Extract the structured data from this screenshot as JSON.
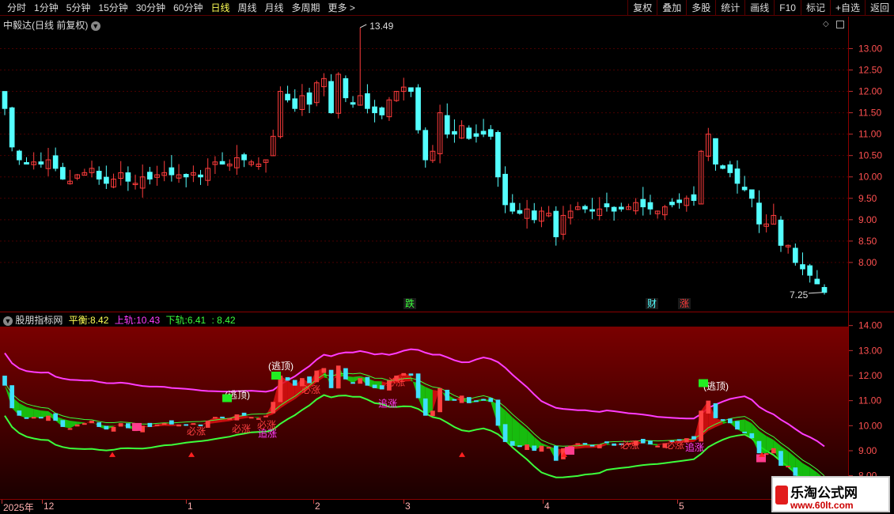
{
  "toolbar": {
    "periods": [
      "分时",
      "1分钟",
      "5分钟",
      "15分钟",
      "30分钟",
      "60分钟",
      "日线",
      "周线",
      "月线",
      "多周期",
      "更多 >"
    ],
    "active": "日线",
    "buttons": [
      "复权",
      "叠加",
      "多股",
      "统计",
      "画线",
      "F10",
      "标记",
      "+自选",
      "返回"
    ]
  },
  "stock": {
    "title": "中毅达(日线 前复权)",
    "high_label": "13.49",
    "low_label": "7.25"
  },
  "main_axis": {
    "ticks": [
      "13.00",
      "12.50",
      "12.00",
      "11.50",
      "11.00",
      "10.50",
      "10.00",
      "9.50",
      "9.00",
      "8.50",
      "8.00"
    ]
  },
  "event_markers": [
    "跌",
    "财",
    "涨"
  ],
  "indicator": {
    "name": "股朋指标网",
    "balance_label": "平衡:",
    "balance_value": "8.42",
    "upper_label": "上轨:",
    "upper_value": "10.43",
    "lower_label": "下轨:",
    "lower_value": "6.41",
    "extra_value": ": 8.42",
    "signals": [
      "必涨",
      "必涨",
      "必涨",
      "必涨",
      "必涨",
      "必涨",
      "必涨",
      "追涨",
      "追涨",
      "追涨",
      "(逃顶)",
      "(逃顶)",
      "(逃顶)"
    ]
  },
  "ind_axis": {
    "ticks": [
      "14.00",
      "13.00",
      "12.00",
      "11.00",
      "10.00",
      "9.00",
      "8.00"
    ]
  },
  "dates": [
    "2025年",
    "12",
    "1",
    "2",
    "3",
    "4",
    "5"
  ],
  "watermark": {
    "title": "乐淘公式网",
    "url": "www.60lt.com"
  },
  "colors": {
    "up": "#ff3c3c",
    "down": "#54ffff",
    "upper_band": "#ff3cff",
    "lower_band": "#3cff3c",
    "background_indicator": "#6a0000"
  },
  "chart_data": {
    "type": "candlestick",
    "title": "中毅达(日线 前复权)",
    "ylim": [
      7.0,
      13.6
    ],
    "highest": 13.49,
    "lowest": 7.25,
    "closes": [
      11.6,
      10.7,
      10.4,
      10.3,
      10.35,
      10.3,
      10.4,
      10.2,
      9.95,
      9.9,
      10.05,
      10.1,
      10.2,
      9.95,
      9.85,
      9.95,
      10.1,
      9.9,
      9.85,
      10.0,
      9.95,
      10.05,
      10.1,
      10.05,
      10.05,
      10.0,
      10.1,
      10.0,
      10.2,
      10.35,
      10.3,
      10.3,
      10.45,
      10.4,
      10.35,
      10.3,
      10.4,
      10.95,
      12.0,
      11.8,
      11.6,
      11.9,
      11.7,
      12.2,
      12.3,
      11.5,
      12.4,
      11.85,
      11.7,
      11.9,
      11.6,
      11.5,
      11.45,
      11.8,
      12.0,
      12.1,
      12.0,
      11.1,
      10.4,
      10.6,
      11.5,
      11.0,
      11.0,
      11.2,
      10.9,
      10.95,
      11.0,
      10.95,
      10.0,
      9.35,
      9.2,
      9.15,
      9.25,
      9.0,
      9.2,
      9.15,
      8.6,
      9.1,
      9.2,
      9.3,
      9.25,
      9.2,
      9.25,
      9.3,
      9.2,
      9.25,
      9.3,
      9.4,
      9.3,
      9.25,
      9.2,
      9.3,
      9.35,
      9.4,
      9.5,
      9.45,
      10.6,
      11.0,
      10.3,
      10.2,
      10.1,
      9.85,
      9.7,
      9.5,
      8.9,
      8.9,
      9.1,
      8.4,
      8.4,
      8.0,
      7.85,
      7.7,
      7.5,
      7.3
    ]
  }
}
